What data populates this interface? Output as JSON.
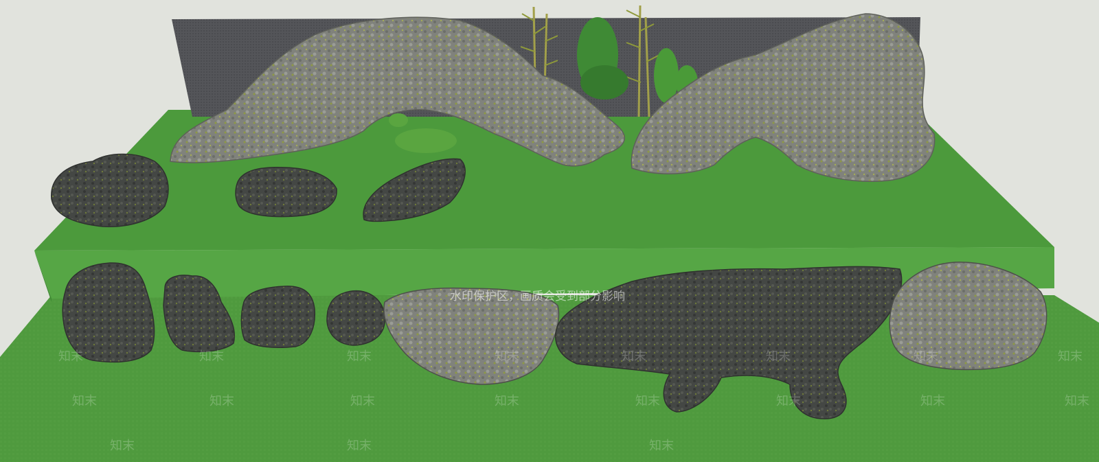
{
  "watermark": {
    "notice": "水印保护区，画质会受到部分影响",
    "brand": "知末"
  },
  "colors": {
    "background": "#e1e3dd",
    "upper_platform_top": "#4c9a3c",
    "upper_platform_front": "#53a443",
    "ground": "#4f9a3e",
    "back_wall": "#545559",
    "rock_grey": "#7d8079",
    "rock_dark": "#3d403d",
    "moss": "#8a9a3a",
    "bamboo": "#a2a04a",
    "foliage": "#3f8a35"
  },
  "scene": {
    "upper_rocks": [
      "arch-rock-left",
      "arch-rock-right",
      "boulder-1",
      "boulder-2",
      "boulder-3"
    ],
    "lower_rocks": [
      "stone-1",
      "stone-2",
      "stone-3",
      "stone-4",
      "stone-5",
      "long-rock",
      "stone-7"
    ],
    "plants": [
      "bamboo-left",
      "bamboo-right",
      "fern-1",
      "fern-2",
      "fern-3"
    ]
  }
}
